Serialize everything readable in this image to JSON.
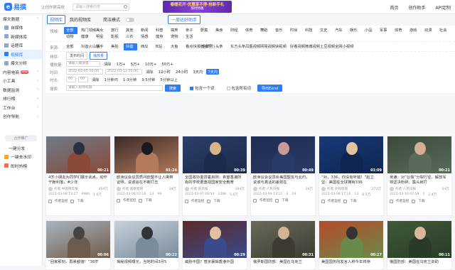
{
  "app": {
    "logo": "易撰",
    "slogan": "让创作更高效",
    "search_placeholder": "请输入搜索内容",
    "banner_line1": "春暖花开·优惠享不停·抢新手礼",
    "banner_line2": "限时特惠",
    "nav": [
      "首页",
      "创作助手",
      "API定制"
    ]
  },
  "sidebar": {
    "items": [
      {
        "label": "爆文数据",
        "kind": "head"
      },
      {
        "label": "自媒体",
        "kind": "sub"
      },
      {
        "label": "新媒体库",
        "kind": "sub"
      },
      {
        "label": "话题库",
        "kind": "sub"
      },
      {
        "label": "视频库",
        "kind": "sub",
        "active": true
      },
      {
        "label": "爆文分析",
        "kind": "sub"
      },
      {
        "label": "内容电商",
        "kind": "head",
        "badge": "NEW"
      },
      {
        "label": "小工具",
        "kind": "head"
      },
      {
        "label": "数据监测",
        "kind": "head"
      },
      {
        "label": "排行榜",
        "kind": "head"
      },
      {
        "label": "工作台",
        "kind": "head"
      },
      {
        "label": "创作导航",
        "kind": "head"
      }
    ],
    "divider": "合作推广",
    "bottom": [
      "一键分发",
      "一键去水印",
      "即时热榜"
    ]
  },
  "tabs": {
    "t1": "视频库",
    "t2": "我的视频库",
    "mode": "简洁模式",
    "promo": "一周达好助手"
  },
  "filters": {
    "field_label": "领域:",
    "fields": [
      "全部",
      "热门领域",
      "美女",
      "旅行",
      "其他",
      "新闻",
      "科普",
      "搞笑",
      "亲子",
      "剧集",
      "美食",
      "财经",
      "体育",
      "舞蹈",
      "音乐",
      "时尚",
      "科技",
      "文史",
      "汽车",
      "娱乐",
      "小品",
      "军事",
      "体育",
      "游戏",
      "动漫",
      "社会",
      "动物",
      "健康",
      "明星",
      "影视",
      "三农",
      "情感",
      "健身",
      "宠物",
      "生活"
    ],
    "source_label": "来源:",
    "sources": [
      "全部",
      "抖音火山版",
      "快手",
      "美拍",
      "抖音",
      "西瓜",
      "B站",
      "大鱼",
      "看点快报(企鹅号)",
      "搜狐号",
      "头条",
      "东方头条",
      "凤凰视频",
      "网易视频",
      "快视频",
      "好看视频",
      "微博视频",
      "土豆视频",
      "全网小视频"
    ],
    "sort_label": "排序:",
    "sorts": [
      "发布时间",
      "播放量"
    ],
    "play_label": "播放量:",
    "play_placeholder": "请输入播放量",
    "play_opts": [
      "清除",
      "1万+",
      "5万+",
      "10万+",
      "50万+"
    ],
    "time_label": "时间:",
    "time_from": "2022-03-05 00:00",
    "time_to": "2022-03-12 00:00",
    "time_opts": [
      "清除",
      "12小时",
      "24小时",
      "3天内",
      "7天内"
    ],
    "dur_label": "时长:",
    "dur_from": "00",
    "dur_to": "00",
    "dur_opts": [
      "清除",
      "1分钟内",
      "1-3分钟",
      "3-5分钟",
      "5分钟以上"
    ],
    "search_label": "搜索:",
    "search_placeholder": "请输入视频标题",
    "search_btn": "搜索",
    "cb1": "包含一个词",
    "cb2": "包含所有词",
    "export_btn": "导出Excel"
  },
  "cards": [
    {
      "title": "4岁小朋友为同学们展示武术，动作干脆利落，#少年",
      "dur": "00:21",
      "author": "作者:中国青年报",
      "views": "450万",
      "date": "2022-03-08 13:27",
      "likes": "4980",
      "comments": "1.6万"
    },
    {
      "title": "欧洲议会议员质问欧盟不让人携带证明，说谎言在不断打击",
      "dur": "01:24",
      "author": "作者:观察者网",
      "views": "38万",
      "date": "2022-03-08 02:16",
      "likes": "13",
      "comments": "99"
    },
    {
      "title": "全国政协委员霍启刚：希望香港所有的学校更重视国家安全教育",
      "dur": "00:39",
      "author": "作者:新京报",
      "views": "284万",
      "date": "2022-03-07 09:54",
      "likes": "1098",
      "comments": "5.6万"
    },
    {
      "title": "欧洲议会议员斥美国盟友与北约，说谎与真话的差别在",
      "dur": "00:49",
      "author": "作者:人民日报",
      "views": "26万",
      "date": "2022-03-09 13:11",
      "likes": "3",
      "comments": "19"
    },
    {
      "title": "“对，336，你没有听错！”赵立坚：美国在全球拥有336",
      "dur": "01:09",
      "author": "作者:央视新闻",
      "views": "272万",
      "date": "2022-03-08 17:16",
      "likes": "13",
      "comments": "8.3万"
    },
    {
      "title": "吴谦：对“台独”分裂行径，解放军将坚决粉碎，露头就打",
      "dur": "00:21",
      "author": "作者:人民日报",
      "views": "54万",
      "date": "2022-03-10 07:59",
      "likes": "1",
      "comments": "2.4万"
    },
    {
      "title": "“回家那刻，再累都值！”38岁",
      "dur": "00:06",
      "author": "",
      "views": "",
      "date": "",
      "likes": "",
      "comments": ""
    },
    {
      "title": "揭秘视频曝光，当地时间3月5",
      "dur": "00:22",
      "author": "",
      "views": "",
      "date": "",
      "likes": "",
      "comments": ""
    },
    {
      "title": "威胁中国？普京暴揭香港中国",
      "dur": "00:29",
      "author": "",
      "views": "",
      "date": "",
      "likes": "",
      "comments": ""
    },
    {
      "title": "俄罗斯国防部：美国在乌克兰",
      "dur": "00:31",
      "author": "",
      "views": "",
      "date": "",
      "likes": "",
      "comments": ""
    },
    {
      "title": "美国国务院发言人称今年将停",
      "dur": "00:27",
      "author": "",
      "views": "",
      "date": "",
      "likes": "",
      "comments": ""
    },
    {
      "title": "俄国防部：美国在乌克兰资助",
      "dur": "00:11",
      "author": "",
      "views": "",
      "date": "",
      "likes": "",
      "comments": ""
    }
  ],
  "card_actions": {
    "monitor": "作者监控",
    "download": "下载"
  }
}
